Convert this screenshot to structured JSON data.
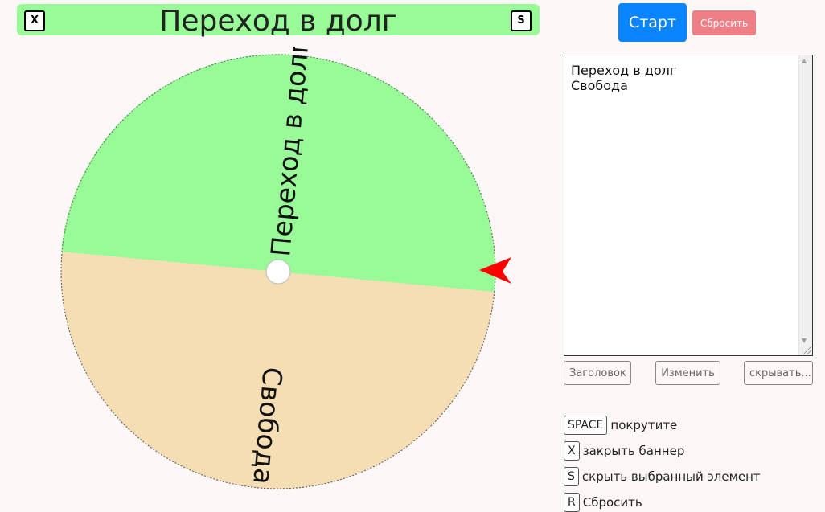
{
  "banner": {
    "title": "Переход в долг",
    "close_key": "X",
    "hide_key": "S",
    "color": "#98fb98"
  },
  "wheel": {
    "segments": [
      {
        "label": "Переход в долг",
        "color": "#98fb98"
      },
      {
        "label": "Свобода",
        "color": "#f5deb3"
      }
    ],
    "pointer_color": "#ff0000"
  },
  "controls": {
    "start_label": "Старт",
    "reset_label": "Сбросить",
    "start_color": "#0b84ff",
    "reset_color": "#ef7f87"
  },
  "editor": {
    "text": "Переход в долг\nСвобода",
    "scroll_up_icon": "▲",
    "scroll_down_icon": "▼"
  },
  "editor_buttons": {
    "title_label": "Заголовок",
    "edit_label": "Изменить",
    "hide_label": "скрывать..."
  },
  "shortcuts": [
    {
      "key": "SPACE",
      "label": "покрутите"
    },
    {
      "key": "X",
      "label": "закрыть баннер"
    },
    {
      "key": "S",
      "label": "скрыть выбранный элемент"
    },
    {
      "key": "R",
      "label": "Сбросить"
    }
  ]
}
